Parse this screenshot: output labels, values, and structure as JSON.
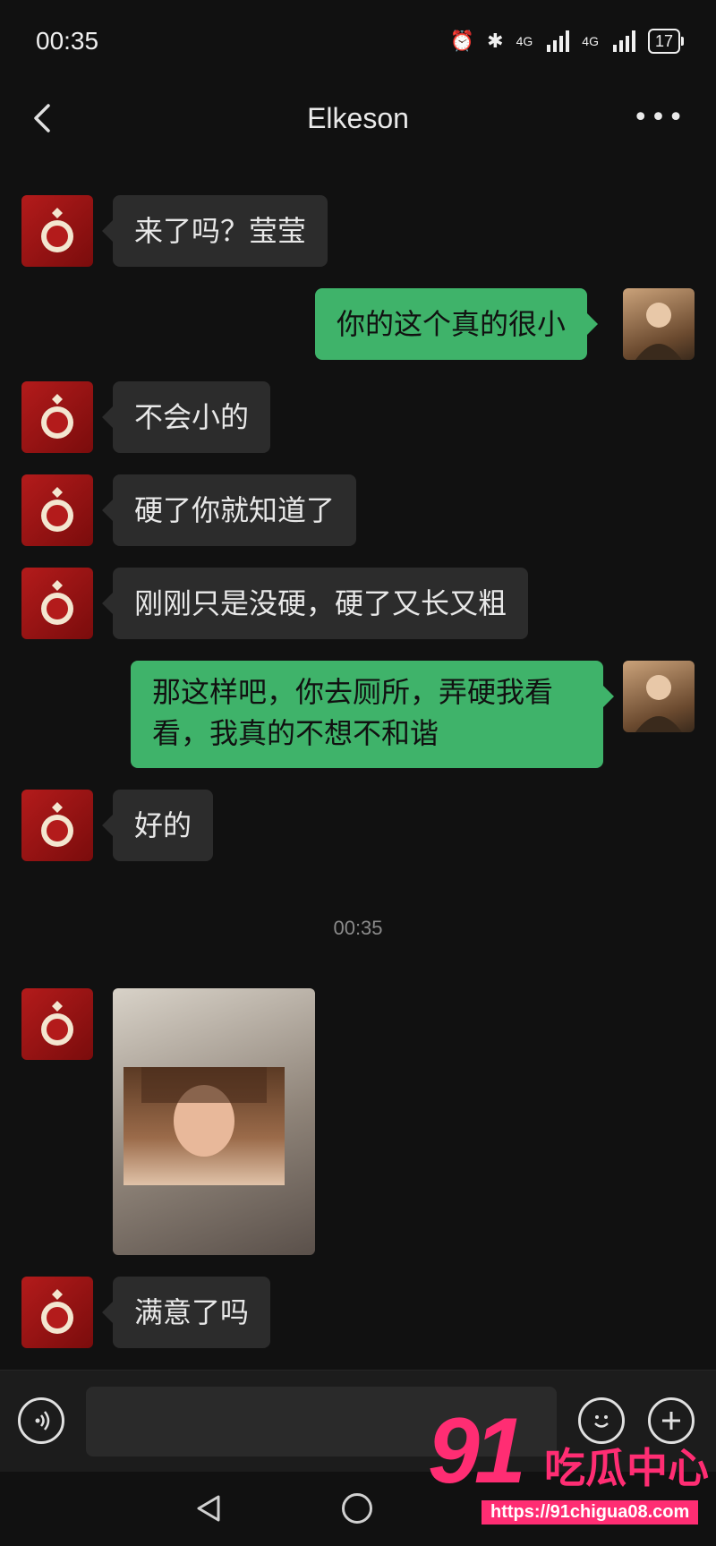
{
  "status_bar": {
    "time": "00:35",
    "network_1": "4G",
    "network_2": "4G",
    "battery": "17"
  },
  "header": {
    "title": "Elkeson"
  },
  "messages": [
    {
      "side": "in",
      "text": "来了吗？莹莹"
    },
    {
      "side": "out",
      "text": "你的这个真的很小"
    },
    {
      "side": "in",
      "text": "不会小的"
    },
    {
      "side": "in",
      "text": "硬了你就知道了"
    },
    {
      "side": "in",
      "text": "刚刚只是没硬，硬了又长又粗"
    },
    {
      "side": "out",
      "text": "那这样吧，你去厕所，弄硬我看看，我真的不想不和谐"
    },
    {
      "side": "in",
      "text": "好的"
    },
    {
      "side": "in",
      "text": "满意了吗"
    }
  ],
  "timestamp": "00:35",
  "watermark": {
    "number": "91",
    "text": "吃瓜中心",
    "url": "https://91chigua08.com"
  },
  "colors": {
    "background": "#111111",
    "incoming_bubble": "#2c2c2c",
    "outgoing_bubble": "#3fb36a",
    "watermark": "#ff2d73"
  }
}
